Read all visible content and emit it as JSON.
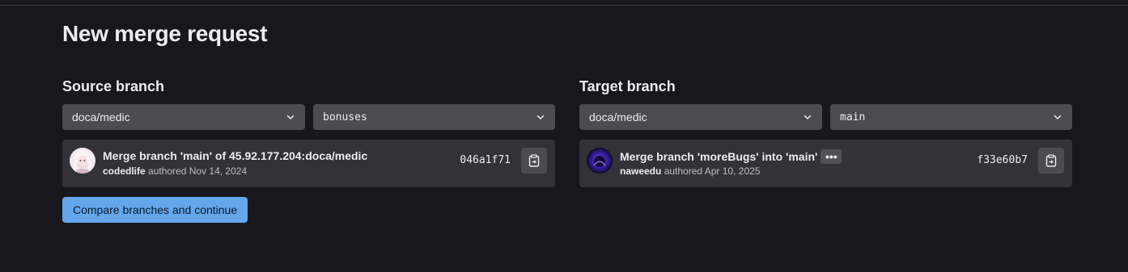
{
  "page": {
    "title": "New merge request",
    "primary_button_label": "Compare branches and continue"
  },
  "source": {
    "heading": "Source branch",
    "project": "doca/medic",
    "branch": "bonuses",
    "commit": {
      "title": "Merge branch 'main' of 45.92.177.204:doca/medic",
      "author": "codedlife",
      "authored_text": "authored Nov 14, 2024",
      "sha": "046a1f71"
    }
  },
  "target": {
    "heading": "Target branch",
    "project": "doca/medic",
    "branch": "main",
    "commit": {
      "title": "Merge branch 'moreBugs' into 'main'",
      "ellipsis": "•••",
      "author": "naweedu",
      "authored_text": "authored Apr 10, 2025",
      "sha": "f33e60b7"
    }
  },
  "icons": {
    "dropdown": "chevron-down-icon",
    "copy": "copy-to-clipboard-icon"
  },
  "colors": {
    "background": "#18171d",
    "card": "#333238",
    "select": "#4c4b51",
    "primary_button": "#63a6e9"
  }
}
